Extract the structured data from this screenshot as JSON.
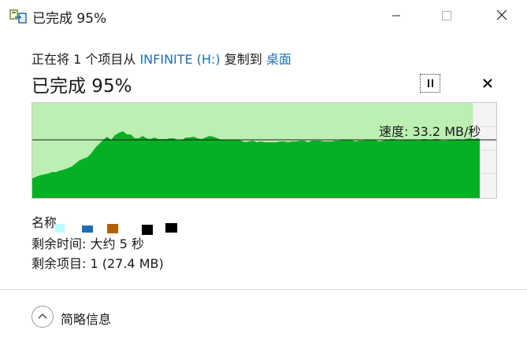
{
  "window": {
    "title": "已完成 95%"
  },
  "header": {
    "prefix": "正在将 1 个项目从 ",
    "source": "INFINITE (H:)",
    "middle": " 复制到 ",
    "destination": "桌面",
    "status": "已完成 95%"
  },
  "progress": {
    "percent": 95
  },
  "speed": {
    "label": "速度: 33.2 MB/秒",
    "value_mb_s": 33.2
  },
  "details": {
    "name_label": "名称",
    "time_remaining": "剩余时间: 大约 5 秒",
    "items_remaining": "剩余项目: 1 (27.4 MB)"
  },
  "footer": {
    "toggle_label": "简略信息"
  },
  "colors": {
    "link": "#1f6fb2",
    "chart_fill": "#06b025",
    "chart_bg": "#bcefb2",
    "chart_border": "#c9c9c9"
  },
  "icons": {
    "app": "copy-file-icon",
    "minimize": "minimize-icon",
    "maximize": "maximize-icon",
    "close": "close-icon",
    "pause": "pause-icon",
    "cancel": "cancel-icon",
    "toggle": "chevron-up-icon"
  }
}
